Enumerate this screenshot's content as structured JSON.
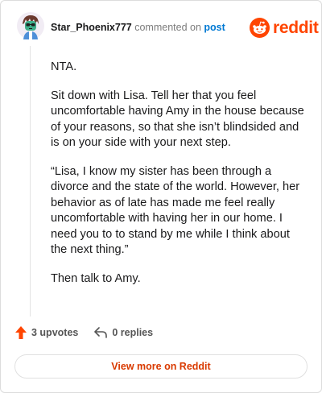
{
  "header": {
    "username": "Star_Phoenix777",
    "action_text": "commented on",
    "post_link": "post",
    "brand": "reddit",
    "brand_color": "#ff4500"
  },
  "comment": {
    "paragraphs": [
      "NTA.",
      "Sit down with Lisa. Tell her that you feel uncomfortable having Amy in the house because of your reasons, so that she isn’t blindsided and is on your side with your next step.",
      "“Lisa, I know my sister has been through a divorce and the state of the world. However, her behavior as of late has made me feel really uncomfortable with having her in our home. I need you to to stand by me while I think about the next thing.”",
      "Then talk to Amy."
    ]
  },
  "actions": {
    "upvotes": "3 upvotes",
    "replies": "0 replies"
  },
  "footer": {
    "view_more": "View more on Reddit"
  },
  "icons": {
    "upvote": "upvote-arrow-icon",
    "reply": "reply-arrow-icon",
    "brand": "reddit-snoo-icon",
    "avatar": "user-avatar"
  }
}
